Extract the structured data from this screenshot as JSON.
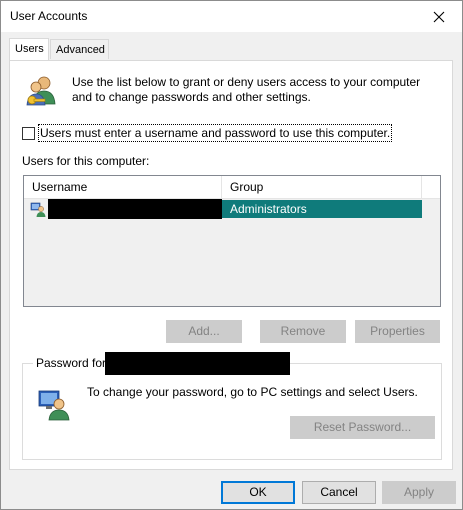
{
  "window": {
    "title": "User Accounts"
  },
  "tabs": [
    {
      "label": "Users",
      "active": true
    },
    {
      "label": "Advanced",
      "active": false
    }
  ],
  "intro": {
    "text": "Use the list below to grant or deny users access to your computer and to change passwords and other settings.",
    "icon": "users-key-icon"
  },
  "checkbox": {
    "label": "Users must enter a username and password to use this computer.",
    "checked": false
  },
  "users_list": {
    "label": "Users for this computer:",
    "columns": [
      "Username",
      "Group"
    ],
    "rows": [
      {
        "username": "",
        "group": "Administrators",
        "selected": true
      }
    ]
  },
  "list_buttons": {
    "add": "Add...",
    "remove": "Remove",
    "properties": "Properties"
  },
  "password_group": {
    "title": "Password for",
    "text": "To change your password, go to PC settings and select Users.",
    "reset_button": "Reset Password..."
  },
  "dialog_buttons": {
    "ok": "OK",
    "cancel": "Cancel",
    "apply": "Apply"
  },
  "colors": {
    "selection": "#0f7b7b",
    "accent": "#0078d7"
  }
}
